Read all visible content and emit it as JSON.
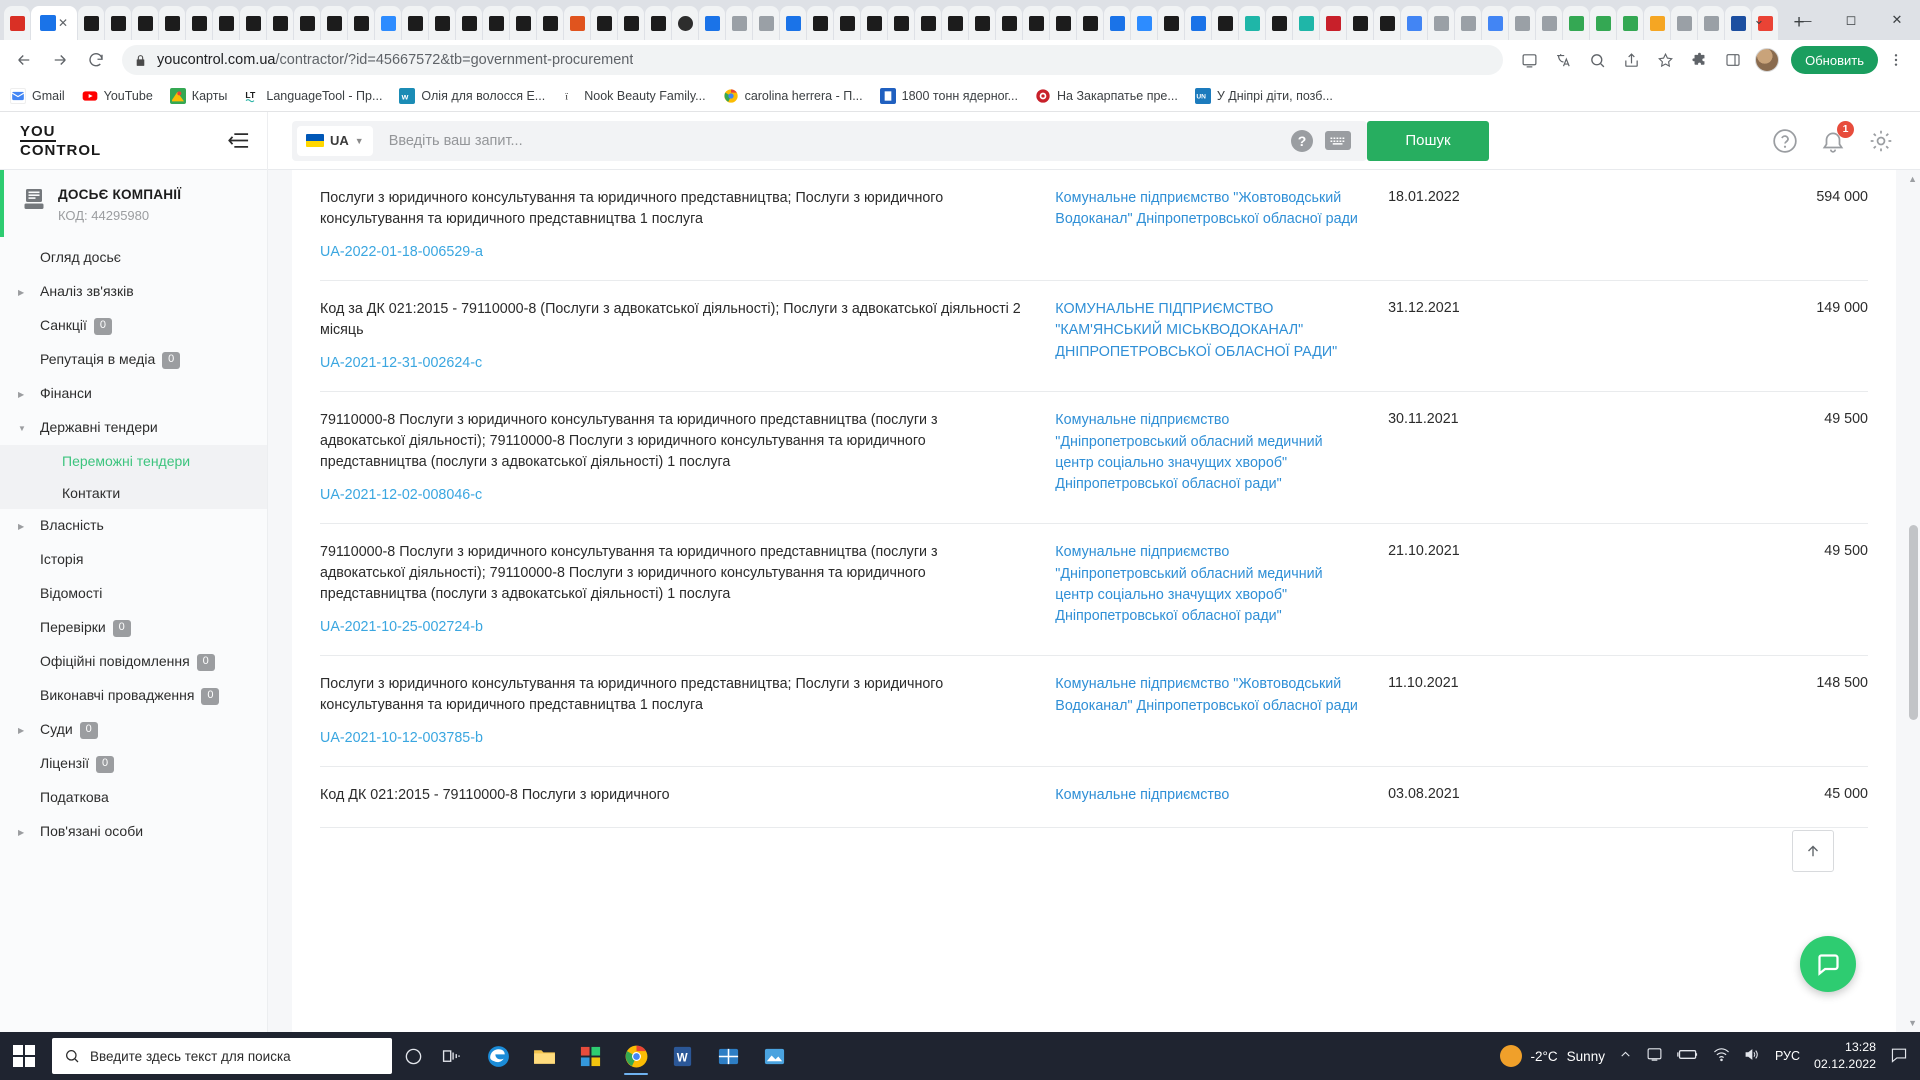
{
  "browser": {
    "url_bold": "youcontrol.com.ua",
    "url_rest": "/contractor/?id=45667572&tb=government-procurement",
    "update_button": "Обновить",
    "new_tab_label": "+",
    "window_controls": [
      "⌄",
      "—",
      "◻",
      "✕"
    ],
    "bookmarks": [
      {
        "label": "Gmail",
        "color": "#ffffff",
        "icon": "gmail-icon"
      },
      {
        "label": "YouTube",
        "color": "#ffffff",
        "icon": "youtube-icon"
      },
      {
        "label": "Карты",
        "color": "#ffffff",
        "icon": "maps-icon"
      },
      {
        "label": "LanguageTool - Пр...",
        "color": "#ffffff",
        "icon": "languagetool-icon"
      },
      {
        "label": "Олія для волосся E...",
        "color": "#1b8cb5",
        "icon": "word-icon"
      },
      {
        "label": "Nook Beauty Family...",
        "color": "#ffffff",
        "icon": "nook-icon"
      },
      {
        "label": "carolina herrera - П...",
        "color": "#ffffff",
        "icon": "chrome-icon"
      },
      {
        "label": "1800 тонн ядерног...",
        "color": "#2060c0",
        "icon": "news-icon"
      },
      {
        "label": "На Закарпатье пре...",
        "color": "#c8202a",
        "icon": "target-icon"
      },
      {
        "label": "У Дніпрі діти, позб...",
        "color": "#1c7bbd",
        "icon": "unian-icon"
      }
    ]
  },
  "site_header": {
    "logo_line1": "YOU",
    "logo_line2": "CONTROL",
    "lang": "UA",
    "search_placeholder": "Введіть ваш запит...",
    "search_value": "",
    "search_button": "Пошук",
    "help_icon": "question-mark-icon",
    "keyboard_icon": "keyboard-icon",
    "notifications_badge": "1"
  },
  "sidebar": {
    "dossier_title": "ДОСЬЄ КОМПАНІЇ",
    "dossier_code": "КОД: 44295980",
    "items": [
      {
        "label": "Огляд досьє",
        "arrow": "",
        "count": null
      },
      {
        "label": "Аналіз зв'язків",
        "arrow": "collapsed",
        "count": null
      },
      {
        "label": "Санкції",
        "arrow": "",
        "count": "0"
      },
      {
        "label": "Репутація в медіа",
        "arrow": "",
        "count": "0"
      },
      {
        "label": "Фінанси",
        "arrow": "collapsed",
        "count": null
      },
      {
        "label": "Державні тендери",
        "arrow": "expanded",
        "count": null
      },
      {
        "label": "Власність",
        "arrow": "collapsed",
        "count": null
      },
      {
        "label": "Історія",
        "arrow": "",
        "count": null
      },
      {
        "label": "Відомості",
        "arrow": "",
        "count": null
      },
      {
        "label": "Перевірки",
        "arrow": "",
        "count": "0"
      },
      {
        "label": "Офіційні повідомлення",
        "arrow": "",
        "count": "0"
      },
      {
        "label": "Виконавчі провадження",
        "arrow": "",
        "count": "0"
      },
      {
        "label": "Суди",
        "arrow": "collapsed",
        "count": "0"
      },
      {
        "label": "Ліцензії",
        "arrow": "",
        "count": "0"
      },
      {
        "label": "Податкова",
        "arrow": "",
        "count": null
      },
      {
        "label": "Пов'язані особи",
        "arrow": "collapsed",
        "count": null
      }
    ],
    "subitems": [
      {
        "label": "Переможні тендери",
        "active": true
      },
      {
        "label": "Контакти",
        "active": false
      }
    ]
  },
  "table": {
    "rows": [
      {
        "subject": "Послуги з юридичного консультування та юридичного представництва; Послуги з юридичного консультування та юридичного представництва 1 послуга",
        "tender_id": "UA-2022-01-18-006529-a",
        "organizer": "Комунальне підприємство \"Жовтоводський Водоканал\" Дніпропетровської обласної ради",
        "date": "18.01.2022",
        "amount": "594 000"
      },
      {
        "subject": "Код за ДК 021:2015 - 79110000-8 (Послуги з адвокатської діяльності); Послуги з адвокатської діяльності 2 місяць",
        "tender_id": "UA-2021-12-31-002624-c",
        "organizer": "КОМУНАЛЬНЕ ПІДПРИЄМСТВО \"КАМ'ЯНСЬКИЙ МІСЬКВОДОКАНАЛ\" ДНІПРОПЕТРОВСЬКОЇ ОБЛАСНОЇ РАДИ\"",
        "date": "31.12.2021",
        "amount": "149 000"
      },
      {
        "subject": "79110000-8 Послуги з юридичного консультування та юридичного представництва (послуги з адвокатської діяльності); 79110000-8 Послуги з юридичного консультування та юридичного представництва (послуги з адвокатської діяльності) 1 послуга",
        "tender_id": "UA-2021-12-02-008046-c",
        "organizer": "Комунальне підприємство \"Дніпропетровський обласний медичний центр соціально значущих хвороб\" Дніпропетровської обласної ради\"",
        "date": "30.11.2021",
        "amount": "49 500"
      },
      {
        "subject": "79110000-8 Послуги з юридичного консультування та юридичного представництва (послуги з адвокатської діяльності); 79110000-8 Послуги з юридичного консультування та юридичного представництва (послуги з адвокатської діяльності) 1 послуга",
        "tender_id": "UA-2021-10-25-002724-b",
        "organizer": "Комунальне підприємство \"Дніпропетровський обласний медичний центр соціально значущих хвороб\" Дніпропетровської обласної ради\"",
        "date": "21.10.2021",
        "amount": "49 500"
      },
      {
        "subject": "Послуги з юридичного консультування та юридичного представництва; Послуги з юридичного консультування та юридичного представництва 1 послуга",
        "tender_id": "UA-2021-10-12-003785-b",
        "organizer": "Комунальне підприємство \"Жовтоводський Водоканал\" Дніпропетровської обласної ради",
        "date": "11.10.2021",
        "amount": "148 500"
      },
      {
        "subject": "Код ДК 021:2015 - 79110000-8 Послуги з юридичного",
        "tender_id": "",
        "organizer": "Комунальне підприємство",
        "date": "03.08.2021",
        "amount": "45 000"
      }
    ]
  },
  "taskbar": {
    "search_placeholder": "Введите здесь текст для поиска",
    "weather_temp": "-2°C",
    "weather_desc": "Sunny",
    "language": "РУС",
    "time": "13:28",
    "date": "02.12.2022"
  }
}
